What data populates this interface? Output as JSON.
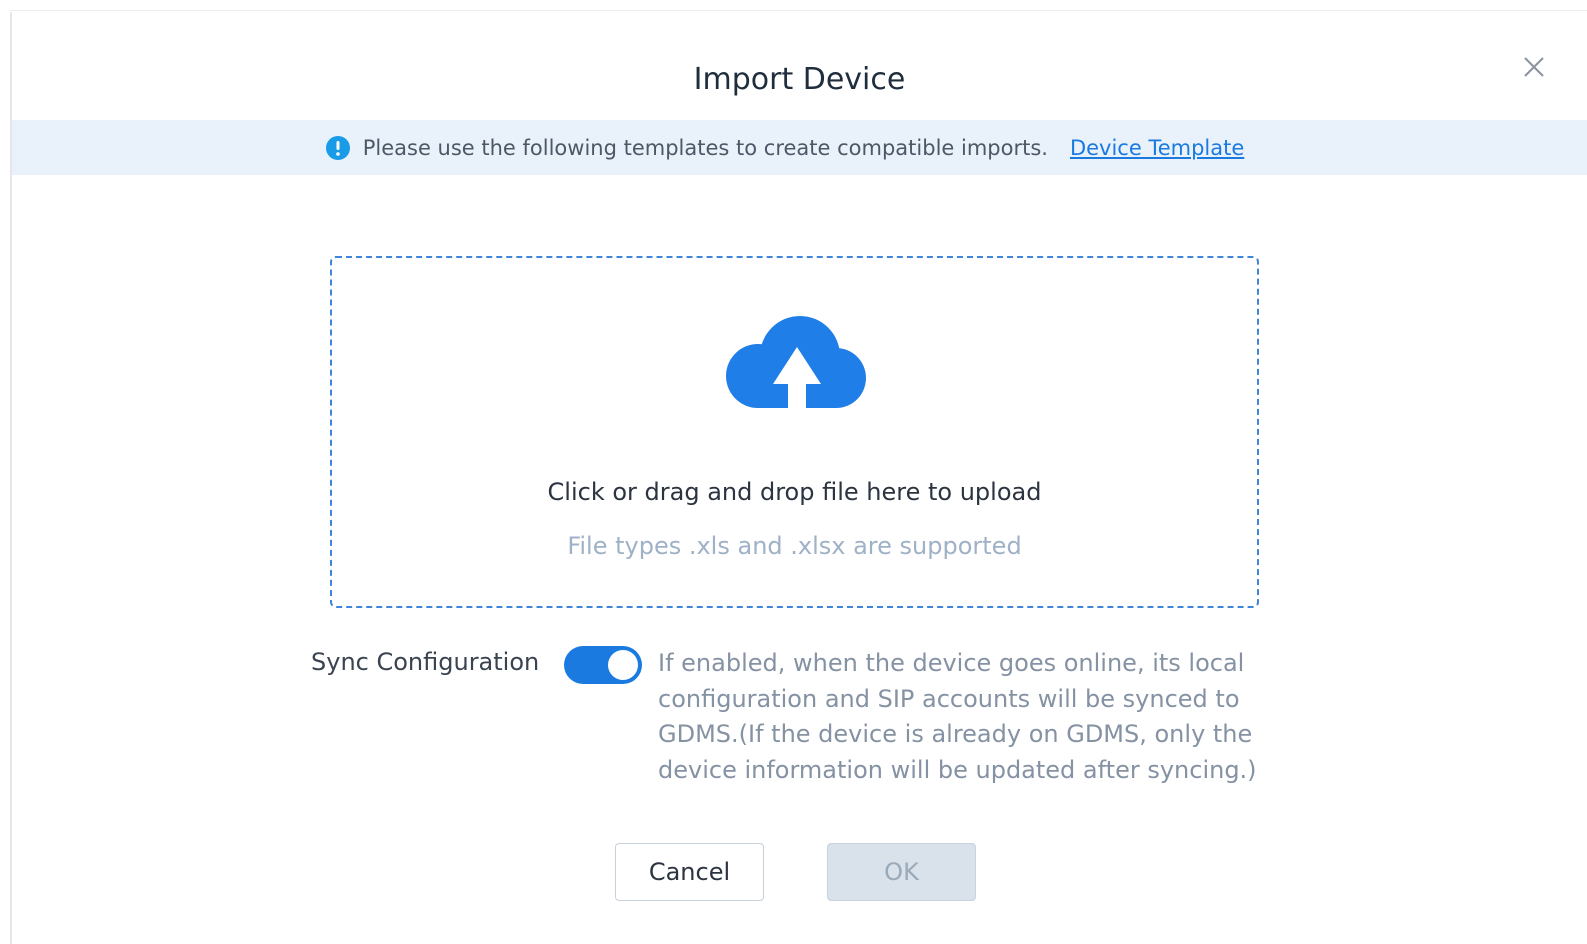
{
  "dialog": {
    "title": "Import Device",
    "close_icon": "close-icon"
  },
  "notice": {
    "icon": "info-icon",
    "text": "Please use the following templates to create compatible imports.",
    "link_text": "Device Template"
  },
  "upload": {
    "icon": "cloud-upload-icon",
    "primary_text": "Click or drag and drop file here to upload",
    "secondary_text": "File types .xls and .xlsx are supported"
  },
  "sync": {
    "label": "Sync Configuration",
    "enabled": true,
    "description": "If enabled, when the device goes online, its local configuration and SIP accounts will be synced to GDMS.(If the device is already on GDMS, only the device information will be updated after syncing.)"
  },
  "buttons": {
    "cancel_label": "Cancel",
    "ok_label": "OK"
  },
  "colors": {
    "accent": "#1a7ae0",
    "notice_bg": "#e9f2fb",
    "disabled_button_bg": "#d9e1ea"
  }
}
